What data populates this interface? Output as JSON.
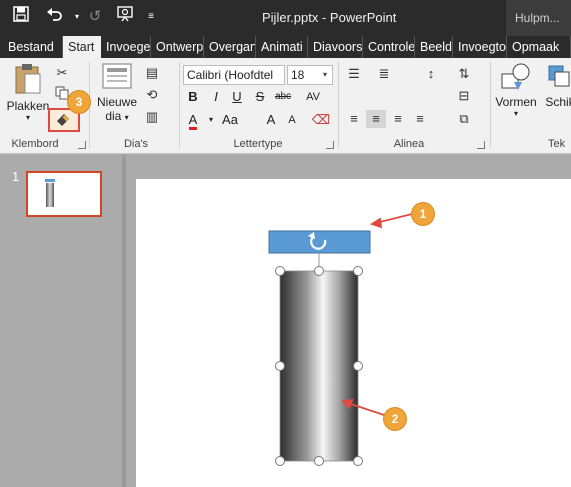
{
  "window": {
    "title": "Pijler.pptx - PowerPoint",
    "helper_text": "Hulpm..."
  },
  "qat": {
    "save_icon": "save-icon",
    "undo_icon": "undo-icon",
    "redo_icon": "redo-icon",
    "present_icon": "present-from-start-icon",
    "customize_icon": "customize-qat-icon"
  },
  "tabs": [
    {
      "label": "Bestand"
    },
    {
      "label": "Start"
    },
    {
      "label": "Invoege"
    },
    {
      "label": "Ontwerp"
    },
    {
      "label": "Overgan"
    },
    {
      "label": "Animati"
    },
    {
      "label": "Diavoors"
    },
    {
      "label": "Controle"
    },
    {
      "label": "Beeld"
    },
    {
      "label": "Invoegto"
    },
    {
      "label": "Opmaak"
    }
  ],
  "ribbon": {
    "clipboard": {
      "paste_label": "Plakken",
      "group_label": "Klembord"
    },
    "slides": {
      "new_slide_line1": "Nieuwe",
      "new_slide_line2": "dia",
      "group_label": "Dia's"
    },
    "font": {
      "font_name": "Calibri (Hoofdtel",
      "font_size": "18",
      "group_label": "Lettertype",
      "bold": "B",
      "italic": "I",
      "underline": "U",
      "strike": "S",
      "abc": "abc",
      "av": "AV",
      "a_color": "A",
      "aa": "Aa",
      "grow": "A",
      "shrink": "A"
    },
    "paragraph": {
      "group_label": "Alinea"
    },
    "drawing": {
      "shapes_label": "Vormen",
      "arrange_label": "Schik",
      "group_label_partial": "Tek"
    }
  },
  "thumbnails": {
    "slide_number": "1"
  },
  "callouts": [
    "1",
    "2",
    "3"
  ],
  "colors": {
    "titlebar": "#2b2b2b",
    "accent_red": "#d24726",
    "callout": "#f0a53a",
    "text_box_fill": "#5b9bd5"
  }
}
